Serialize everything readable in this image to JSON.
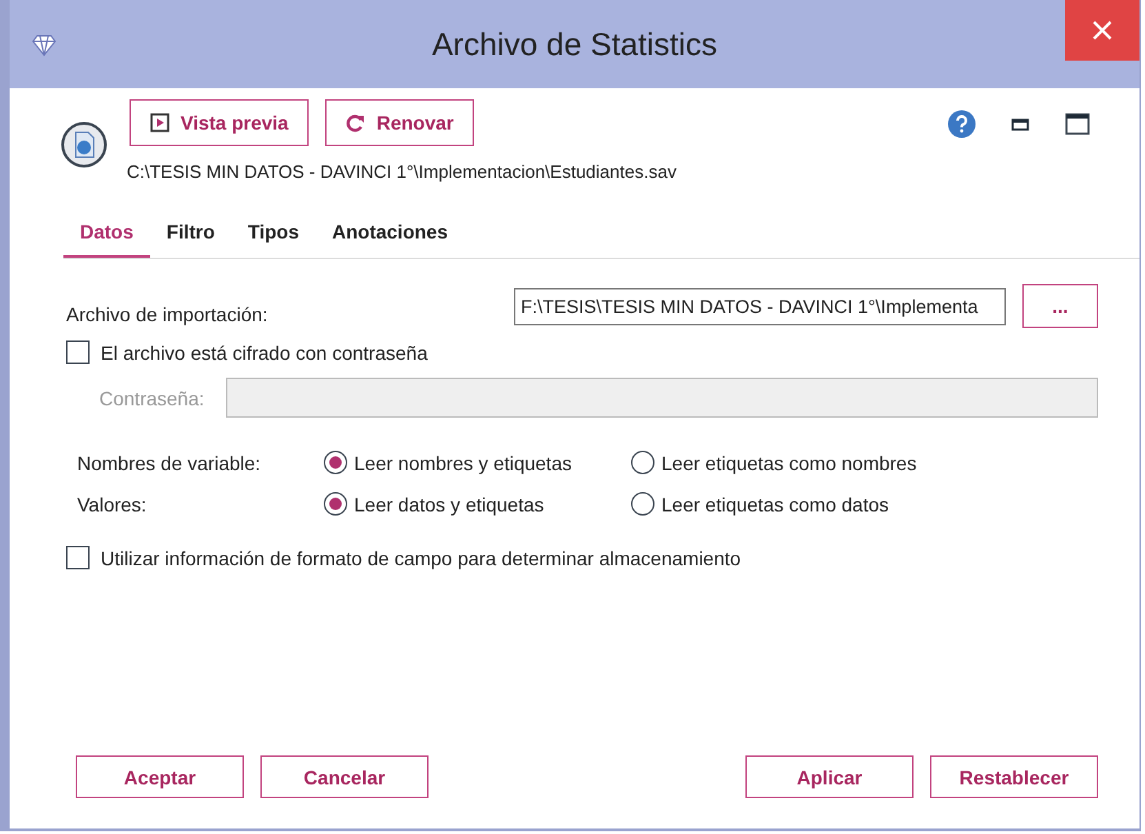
{
  "window": {
    "title": "Archivo de Statistics"
  },
  "toolbar": {
    "buttons": [
      {
        "kind": "preview",
        "label": "Vista previa"
      },
      {
        "kind": "refresh",
        "label": "Renovar"
      }
    ],
    "path": "C:\\TESIS MIN DATOS - DAVINCI 1°\\Implementacion\\Estudiantes.sav"
  },
  "tabs": [
    {
      "label": "Datos",
      "selected": true
    },
    {
      "label": "Filtro",
      "selected": false
    },
    {
      "label": "Tipos",
      "selected": false
    },
    {
      "label": "Anotaciones",
      "selected": false
    }
  ],
  "import_file": {
    "label": "Archivo de importación:",
    "value": "F:\\TESIS\\TESIS MIN DATOS - DAVINCI 1°\\Implementa",
    "browse": "..."
  },
  "encrypted": {
    "label": "El archivo está cifrado con contraseña",
    "checked": false
  },
  "password": {
    "label": "Contraseña:",
    "disabled": true
  },
  "radio_groups": [
    {
      "label": "Nombres de variable:",
      "options": [
        {
          "label": "Leer nombres y etiquetas",
          "selected": true
        },
        {
          "label": "Leer etiquetas como nombres",
          "selected": false
        }
      ]
    },
    {
      "label": "Valores:",
      "options": [
        {
          "label": "Leer datos y etiquetas",
          "selected": true
        },
        {
          "label": "Leer etiquetas como datos",
          "selected": false
        }
      ]
    }
  ],
  "field_format": {
    "label": "Utilizar información de formato de campo para determinar almacenamiento",
    "checked": false
  },
  "footer": {
    "left": [
      "Aceptar",
      "Cancelar"
    ],
    "right": [
      "Aplicar",
      "Restablecer"
    ]
  }
}
